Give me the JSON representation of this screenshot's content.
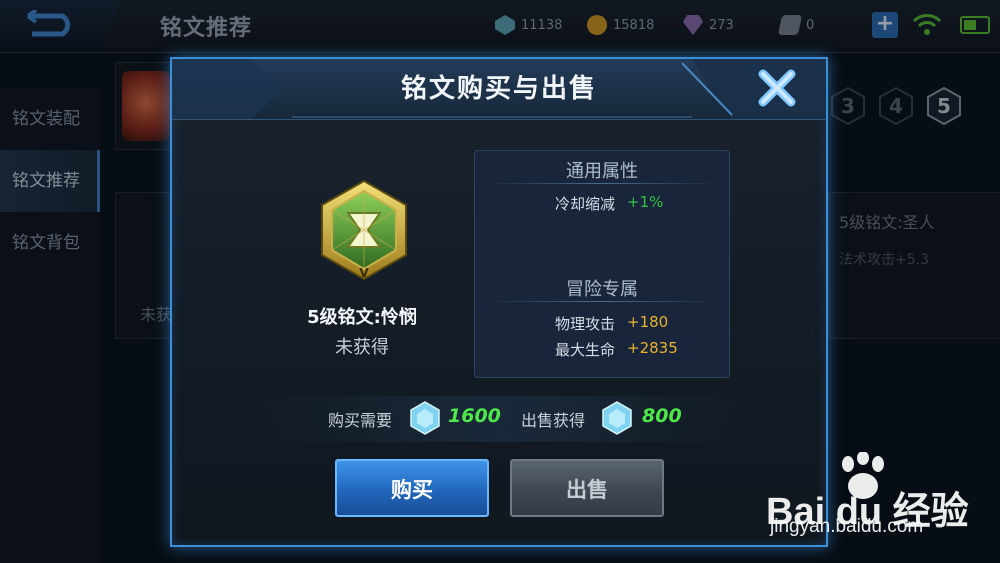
{
  "topbar": {
    "page_title": "铭文推荐",
    "resources": [
      {
        "icon": "gem-icon",
        "value": "11138",
        "color": "#5fa5b8"
      },
      {
        "icon": "gold-coin-icon",
        "value": "15818",
        "color": "#d19a2a"
      },
      {
        "icon": "diamond-icon",
        "value": "273",
        "color": "#8a6fb0"
      },
      {
        "icon": "voucher-icon",
        "value": "0",
        "color": "#7a8592"
      }
    ]
  },
  "sidebar": {
    "items": [
      {
        "label": "铭文装配"
      },
      {
        "label": "铭文推荐"
      },
      {
        "label": "铭文背包"
      }
    ]
  },
  "background": {
    "levels": [
      "3",
      "4",
      "5"
    ],
    "side_title": "5级铭文:圣人",
    "side_desc": "法术攻击+5.3",
    "left_status": "未获"
  },
  "dialog": {
    "title": "铭文购买与出售",
    "rune": {
      "name": "5级铭文:怜悯",
      "status": "未获得",
      "rune_level_mark": "V"
    },
    "general": {
      "title": "通用属性",
      "attrs": [
        {
          "name": "冷却缩减",
          "value": "+1%",
          "color": "#35c241"
        }
      ]
    },
    "adventure": {
      "title": "冒险专属",
      "attrs": [
        {
          "name": "物理攻击",
          "value": "+180",
          "color": "#e8b330"
        },
        {
          "name": "最大生命",
          "value": "+2835",
          "color": "#e8b330"
        }
      ]
    },
    "buy_price": {
      "label": "购买需要",
      "value": "1600"
    },
    "sell_price": {
      "label": "出售获得",
      "value": "800"
    },
    "buy_button": "购买",
    "sell_button": "出售"
  },
  "watermark": {
    "logo": "Bai du 经验",
    "url": "jingyan.baidu.com"
  }
}
